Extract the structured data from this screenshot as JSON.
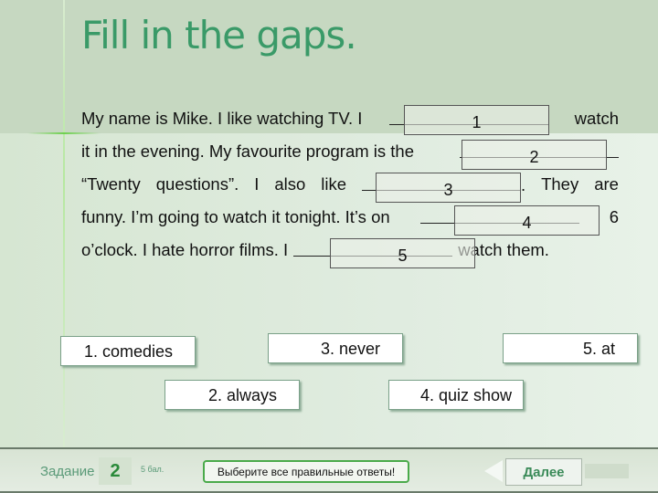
{
  "title": "Fill in the gaps.",
  "text": {
    "l1": [
      "My name is Mike. I like watching TV. I",
      "watch"
    ],
    "l2": [
      "it in the evening. My favourite program is the"
    ],
    "l3": [
      "“Twenty",
      "questions”.",
      "I",
      "also",
      "like",
      ".",
      "They",
      "are"
    ],
    "l4": [
      "funny. I’m going to watch it tonight. It’s on",
      "6"
    ],
    "l5": [
      "o’clock. I hate horror films. I",
      "watch them."
    ]
  },
  "gaps": [
    "1",
    "2",
    "3",
    "4",
    "5"
  ],
  "answers": [
    "1. comedies",
    "2. always",
    "3. never",
    "4. quiz show",
    "5. at"
  ],
  "footer": {
    "task_label": "Задание",
    "task_number": "2",
    "points": "5 бал.",
    "hint": "Выберите все правильные ответы!",
    "next_label": "Далее"
  }
}
